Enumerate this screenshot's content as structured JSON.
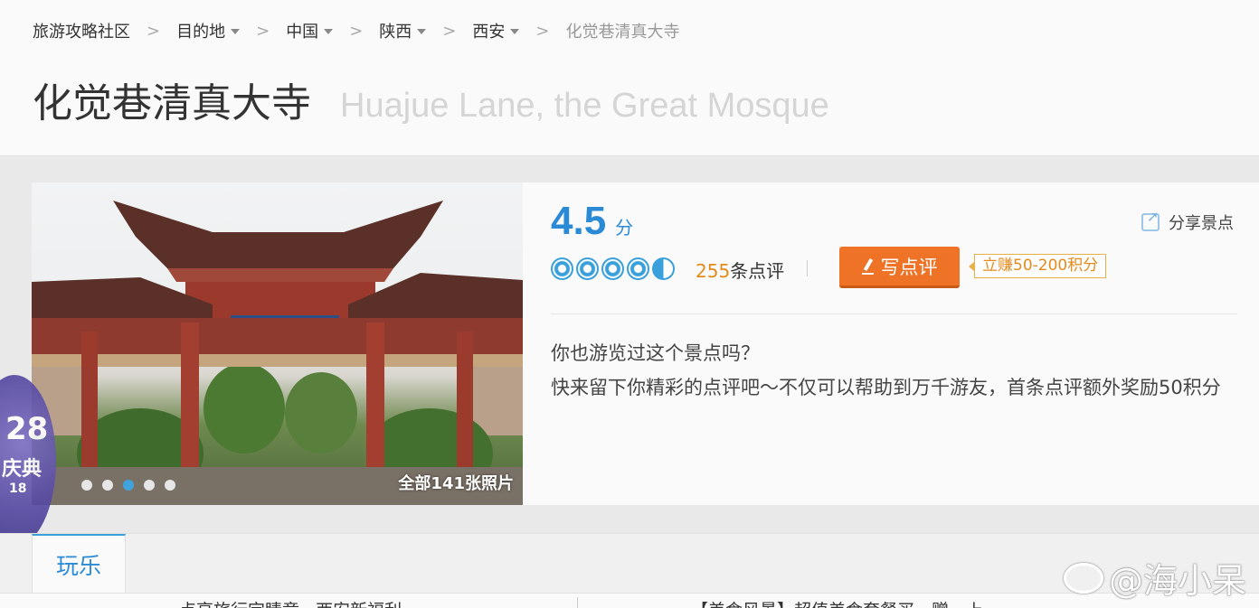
{
  "breadcrumb": {
    "items": [
      {
        "label": "旅游攻略社区",
        "dropdown": false
      },
      {
        "label": "目的地",
        "dropdown": true
      },
      {
        "label": "中国",
        "dropdown": true
      },
      {
        "label": "陕西",
        "dropdown": true
      },
      {
        "label": "西安",
        "dropdown": true
      }
    ],
    "current": "化觉巷清真大寺",
    "separator": ">"
  },
  "title": {
    "cn": "化觉巷清真大寺",
    "en": "Huajue Lane, the Great Mosque"
  },
  "photo": {
    "count_label": "全部141张照片",
    "dots": 5,
    "active_dot": 2
  },
  "rating": {
    "score": "4.5",
    "unit": "分",
    "stars": 4.5,
    "review_count": "255",
    "review_suffix": "条点评"
  },
  "actions": {
    "write_review": "写点评",
    "bonus": "立赚50-200积分",
    "share": "分享景点"
  },
  "prompt": {
    "line1": "你也游览过这个景点吗？",
    "line2": "快来留下你精彩的点评吧～不仅可以帮助到万千游友，首条点评额外奖励50积分"
  },
  "tabs": [
    {
      "label": "玩乐",
      "active": true
    }
  ],
  "footer_snippets": {
    "left": "点亮旅行定睛章 · 西安新福利",
    "right": "【美食风景】超值美食套餐买一赠一上"
  },
  "badge": {
    "text1": "28",
    "text2": "庆典",
    "text3": "18"
  },
  "watermark": "@海小呆",
  "colors": {
    "accent": "#2b8ad6",
    "orange": "#ef7326",
    "bonus": "#e48a1c"
  }
}
